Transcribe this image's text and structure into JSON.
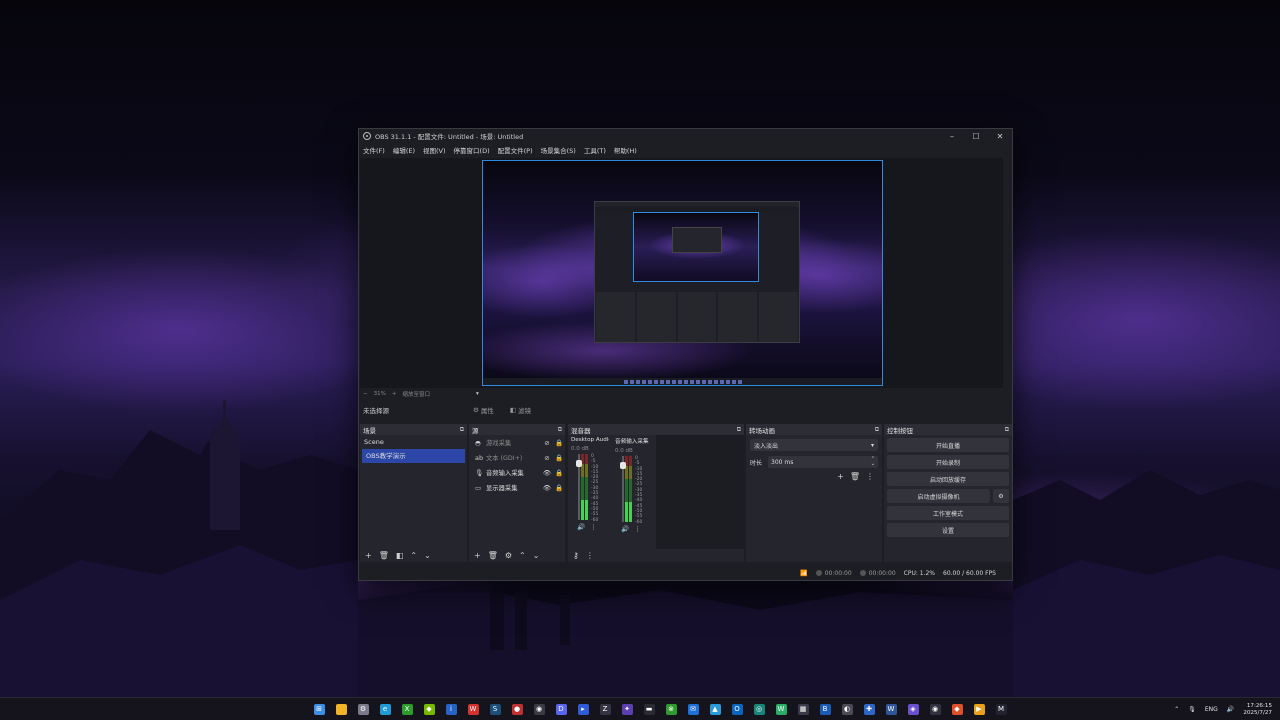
{
  "window": {
    "title": "OBS 31.1.1 - 配置文件: Untitled - 场景: Untitled",
    "min": "–",
    "max": "☐",
    "close": "✕"
  },
  "menu": [
    "文件(F)",
    "编辑(E)",
    "视图(V)",
    "停靠窗口(D)",
    "配置文件(P)",
    "场景集合(S)",
    "工具(T)",
    "帮助(H)"
  ],
  "zoom": {
    "minus": "−",
    "value": "31%",
    "plus": "+",
    "mode": "缩放至窗口",
    "arrow": "▾"
  },
  "source_bar": {
    "no_source": "未选择源",
    "properties": "属性",
    "filters": "滤镜"
  },
  "scenes": {
    "title": "场景",
    "items": [
      {
        "label": "Scene",
        "selected": false
      },
      {
        "label": "OBS教学演示",
        "selected": true
      }
    ]
  },
  "sources": {
    "title": "源",
    "items": [
      {
        "label": "游戏采集",
        "icon": "gamepad-icon",
        "disabled": true
      },
      {
        "label": "文本 (GDI+)",
        "icon": "text-icon",
        "disabled": true
      },
      {
        "label": "音频输入采集",
        "icon": "microphone-icon",
        "disabled": false
      },
      {
        "label": "显示器采集",
        "icon": "monitor-icon",
        "disabled": false
      }
    ]
  },
  "mixer": {
    "title": "混音器",
    "channels": [
      {
        "name": "Desktop Audio",
        "db": "0.0 dB",
        "level": 0.3
      },
      {
        "name": "音频输入采集",
        "db": "0.0 dB",
        "level": 0.3
      }
    ],
    "scale": [
      "0",
      "-5",
      "-10",
      "-15",
      "-20",
      "-25",
      "-30",
      "-35",
      "-40",
      "-45",
      "-50",
      "-55",
      "-60"
    ]
  },
  "transitions": {
    "title": "转场动画",
    "type": "淡入淡出",
    "duration_label": "时长",
    "duration": "300 ms"
  },
  "controls": {
    "title": "控制按钮",
    "start_stream": "开始直播",
    "start_record": "开始录制",
    "replay_buffer": "启动回放缓存",
    "virtual_cam": "启动虚拟摄像机",
    "studio_mode": "工作室模式",
    "settings": "设置"
  },
  "status": {
    "stream_time": "00:00:00",
    "record_time": "00:00:00",
    "cpu": "CPU: 1.2%",
    "fps": "60.00 / 60.00 FPS"
  },
  "taskbar": {
    "apps": [
      {
        "name": "start-icon",
        "color": "#3b8ee8",
        "glyph": "⊞"
      },
      {
        "name": "file-explorer-icon",
        "color": "#f0b429",
        "glyph": ""
      },
      {
        "name": "settings-icon",
        "color": "#7a7a8a",
        "glyph": "⚙"
      },
      {
        "name": "edge-icon",
        "color": "#1f9ad6",
        "glyph": "e"
      },
      {
        "name": "xbox-icon",
        "color": "#2d9b2d",
        "glyph": "X"
      },
      {
        "name": "nvidia-icon",
        "color": "#76b900",
        "glyph": "◆"
      },
      {
        "name": "info-icon",
        "color": "#2563c9",
        "glyph": "i"
      },
      {
        "name": "weibo-icon",
        "color": "#d6312e",
        "glyph": "W"
      },
      {
        "name": "steam-icon",
        "color": "#1b4f7a",
        "glyph": "S"
      },
      {
        "name": "app-icon-red",
        "color": "#c03030",
        "glyph": "●"
      },
      {
        "name": "obs-icon",
        "color": "#3a3a44",
        "glyph": "◉"
      },
      {
        "name": "discord-icon",
        "color": "#5865f2",
        "glyph": "D"
      },
      {
        "name": "app-icon-blue",
        "color": "#2f5bd6",
        "glyph": "▸"
      },
      {
        "name": "zlibrary-icon",
        "color": "#333344",
        "glyph": "Z"
      },
      {
        "name": "app-icon-purple",
        "color": "#5b3fb0",
        "glyph": "✦"
      },
      {
        "name": "app-icon-dark",
        "color": "#2a2a33",
        "glyph": "▬"
      },
      {
        "name": "xbox-app-icon",
        "color": "#2d9b2d",
        "glyph": "⊗"
      },
      {
        "name": "mail-icon",
        "color": "#1f6fd6",
        "glyph": "✉"
      },
      {
        "name": "photos-icon",
        "color": "#2a9bd8",
        "glyph": "▲"
      },
      {
        "name": "outlook-icon",
        "color": "#0a64c2",
        "glyph": "O"
      },
      {
        "name": "app-icon-teal",
        "color": "#17867a",
        "glyph": "◎"
      },
      {
        "name": "wechat-icon",
        "color": "#2aae67",
        "glyph": "W"
      },
      {
        "name": "calculator-icon",
        "color": "#3a3a48",
        "glyph": "▦"
      },
      {
        "name": "bg-icon",
        "color": "#1a5bb8",
        "glyph": "B"
      },
      {
        "name": "app-icon-gray",
        "color": "#4a4a58",
        "glyph": "◐"
      },
      {
        "name": "app-icon-blue2",
        "color": "#2d66c8",
        "glyph": "✚"
      },
      {
        "name": "word-icon",
        "color": "#2b579a",
        "glyph": "W"
      },
      {
        "name": "app-icon-violet",
        "color": "#6a4fd0",
        "glyph": "◈"
      },
      {
        "name": "obs-taskbar-icon",
        "color": "#303040",
        "glyph": "◉"
      },
      {
        "name": "app-icon-orange",
        "color": "#e0502a",
        "glyph": "◆"
      },
      {
        "name": "app-icon-yellow",
        "color": "#e8a019",
        "glyph": "▶"
      },
      {
        "name": "app-icon-m",
        "color": "#222230",
        "glyph": "M"
      }
    ],
    "tray": {
      "chevron": "⌃",
      "mic": "🎙",
      "lang": "ENG",
      "volume": "🔊",
      "time": "17:26:15",
      "date": "2025/7/27"
    }
  }
}
